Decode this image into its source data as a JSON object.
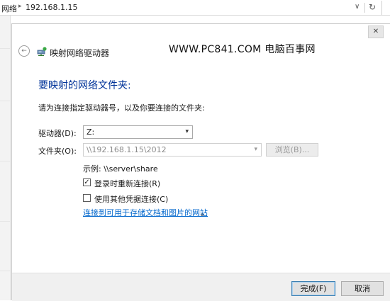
{
  "explorer": {
    "breadcrumb": "网络",
    "address": "192.168.1.15"
  },
  "dialog": {
    "title": "映射网络驱动器",
    "watermark": "WWW.PC841.COM 电脑百事网",
    "heading": "要映射的网络文件夹:",
    "instruction": "请为连接指定驱动器号，以及你要连接的文件夹:",
    "drive": {
      "label": "驱动器(D):",
      "value": "Z:"
    },
    "folder": {
      "label": "文件夹(O):",
      "value": "\\\\192.168.1.15\\2012"
    },
    "browse_label": "浏览(B)...",
    "example": "示例: \\\\server\\share",
    "reconnect": {
      "label": "登录时重新连接(R)",
      "checked": true
    },
    "other_credentials": {
      "label": "使用其他凭据连接(C)",
      "checked": false
    },
    "link_text": "连接到可用于存储文档和图片的网站",
    "link_suffix": "。",
    "finish_label": "完成(F)",
    "cancel_label": "取消"
  },
  "colors": {
    "heading": "#003399",
    "link": "#0066cc",
    "primary_border": "#3c7fb1"
  }
}
